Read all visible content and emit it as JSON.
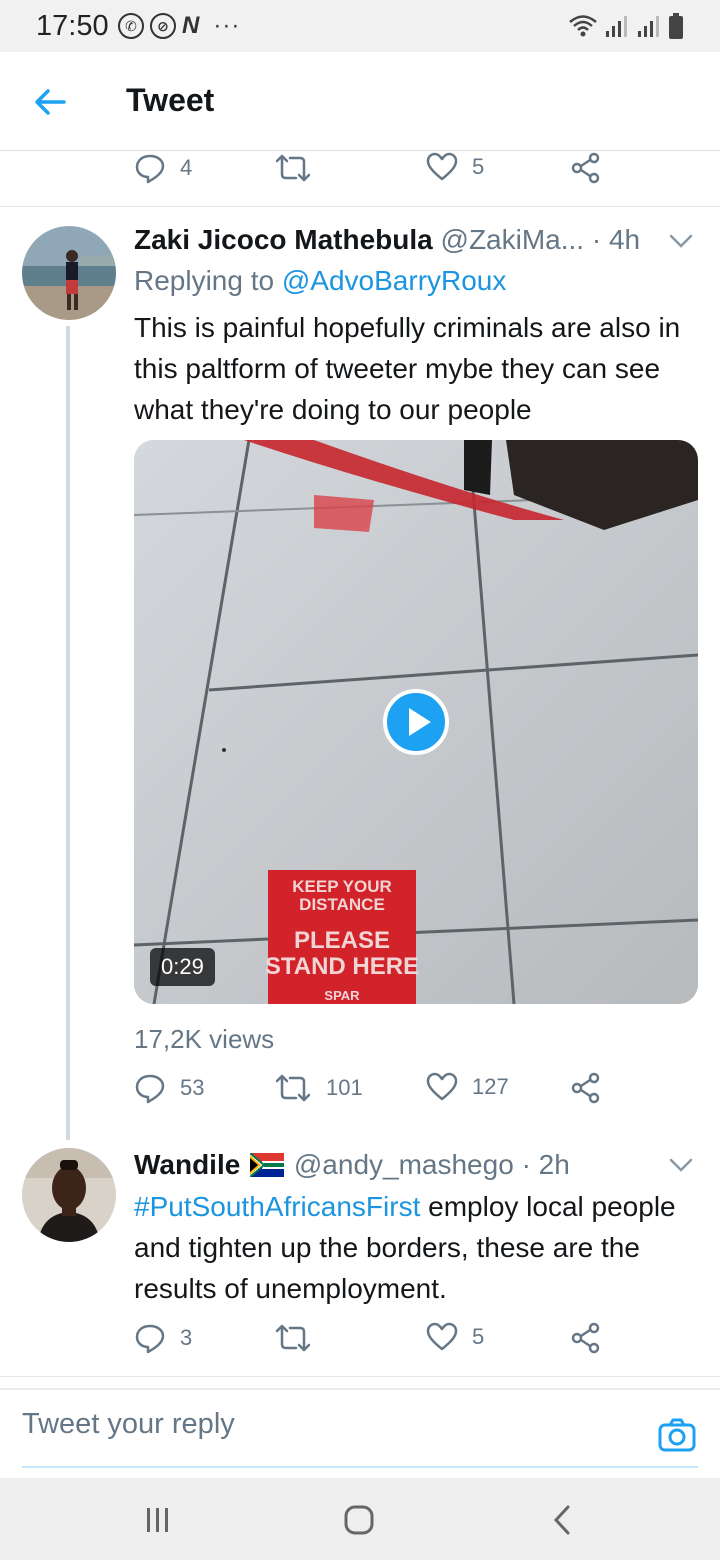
{
  "status_bar": {
    "time": "17:50",
    "dots": "···"
  },
  "header": {
    "title": "Tweet"
  },
  "prev_actions": {
    "replies": "4",
    "likes": "5"
  },
  "tweet1": {
    "name": "Zaki Jicoco Mathebula",
    "handle": "@ZakiMa...",
    "time": "· 4h",
    "replying_label": "Replying to ",
    "replying_to": "@AdvoBarryRoux",
    "text": "This is painful hopefully criminals are also in this paltform of tweeter mybe they can see what they're doing to our people",
    "video": {
      "duration": "0:29",
      "sign_line1": "KEEP YOUR",
      "sign_line2": "DISTANCE",
      "sign_line3": "PLEASE",
      "sign_line4": "STAND HERE",
      "sign_line5": "SPAR"
    },
    "views": "17,2K views",
    "replies": "53",
    "retweets": "101",
    "likes": "127"
  },
  "tweet2": {
    "name": "Wandile",
    "flag": "south-africa-flag",
    "handle": "@andy_mashego",
    "time": "· 2h",
    "hashtag": "#PutSouthAfricansFirst",
    "text": " employ local people and tighten up the borders, these are the results of unemployment.",
    "replies": "3",
    "likes": "5"
  },
  "reply_bar": {
    "placeholder": "Tweet your reply"
  },
  "colors": {
    "accent": "#1da1f2",
    "secondary_text": "#657786"
  }
}
